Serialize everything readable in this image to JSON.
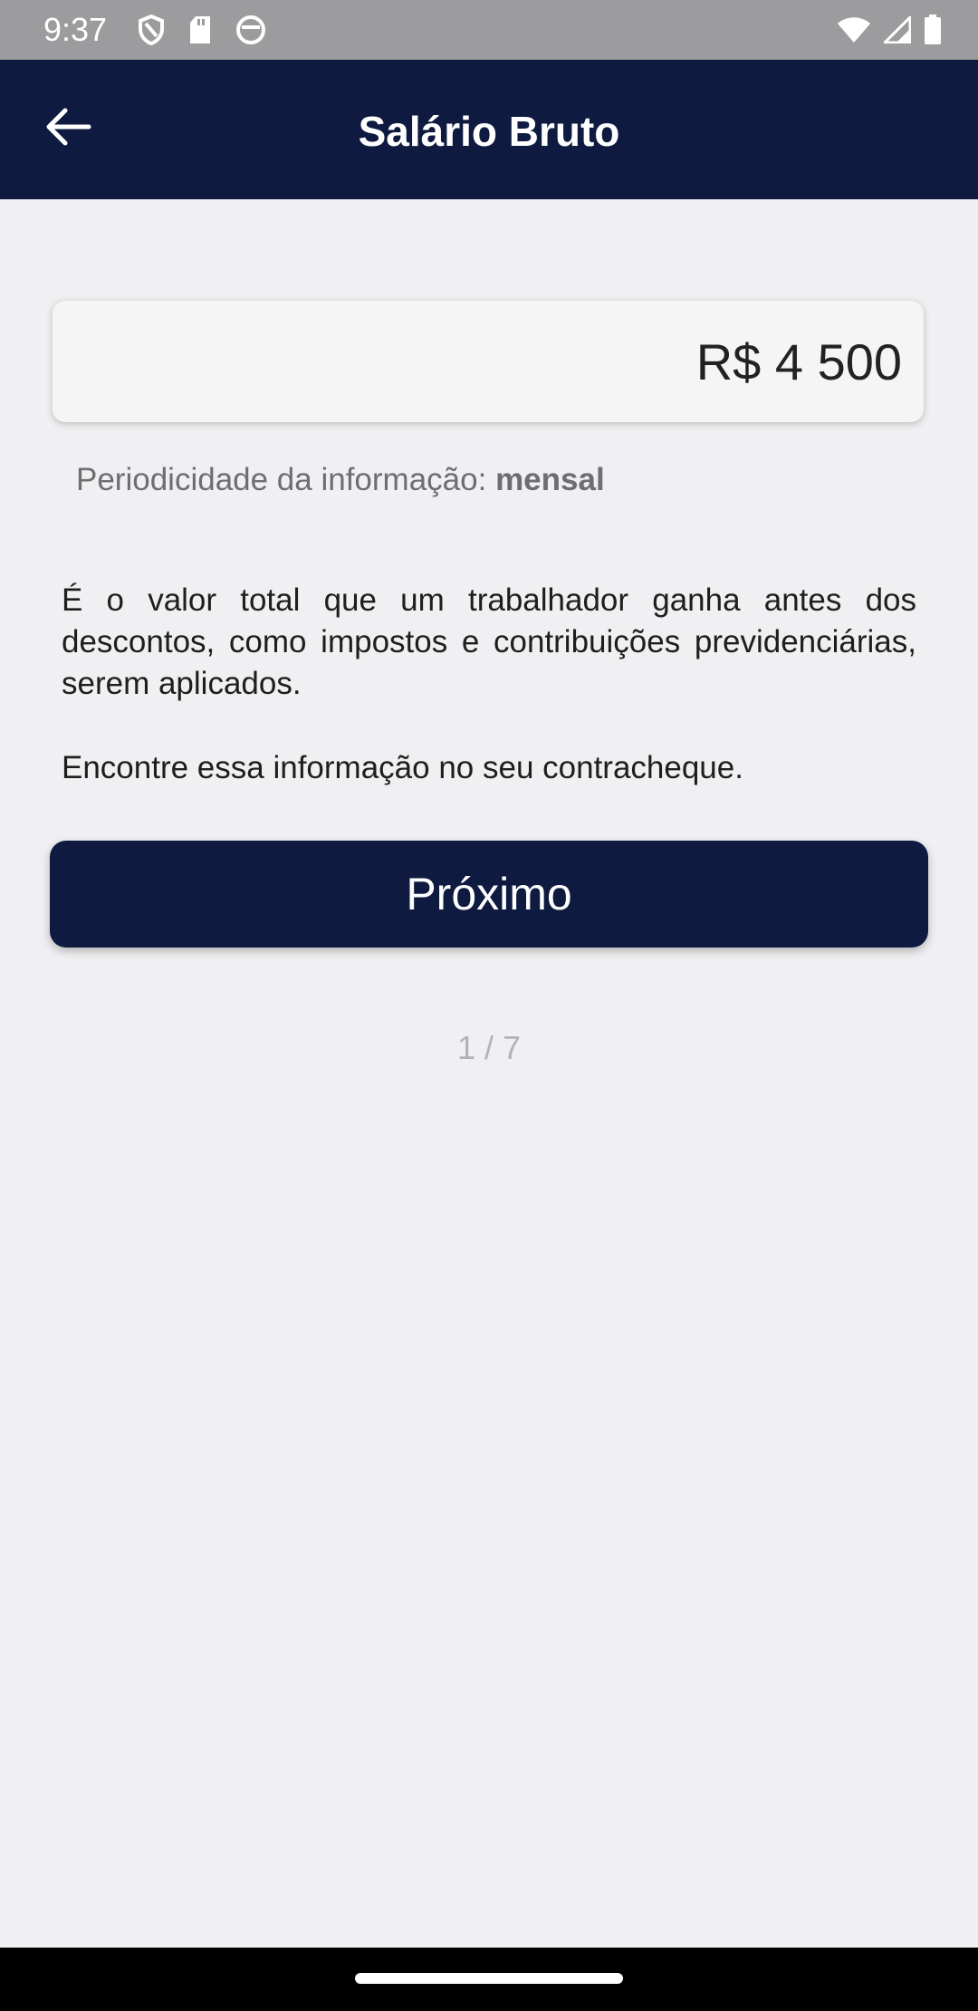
{
  "status_bar": {
    "time": "9:37",
    "icons_left": [
      "shield-icon",
      "sd-card-icon",
      "circle-app-icon"
    ],
    "icons_right": [
      "wifi-icon",
      "signal-icon",
      "battery-icon"
    ]
  },
  "app_bar": {
    "title": "Salário Bruto",
    "back_icon": "arrow-left-icon",
    "background": "#0e1a3f"
  },
  "form": {
    "amount_value": "R$ 4 500",
    "periodicity_label": "Periodicidade da informação: ",
    "periodicity_value": "mensal"
  },
  "info": {
    "description": "É o valor total que um trabalhador ganha antes dos descontos, como impostos e contribuições previdenciárias, serem aplicados.",
    "hint": "Encontre essa informação no seu contracheque."
  },
  "actions": {
    "next_label": "Próximo"
  },
  "progress": {
    "indicator": "1 / 7"
  },
  "colors": {
    "primary": "#0e1a3f",
    "background": "#f0f0f2"
  }
}
